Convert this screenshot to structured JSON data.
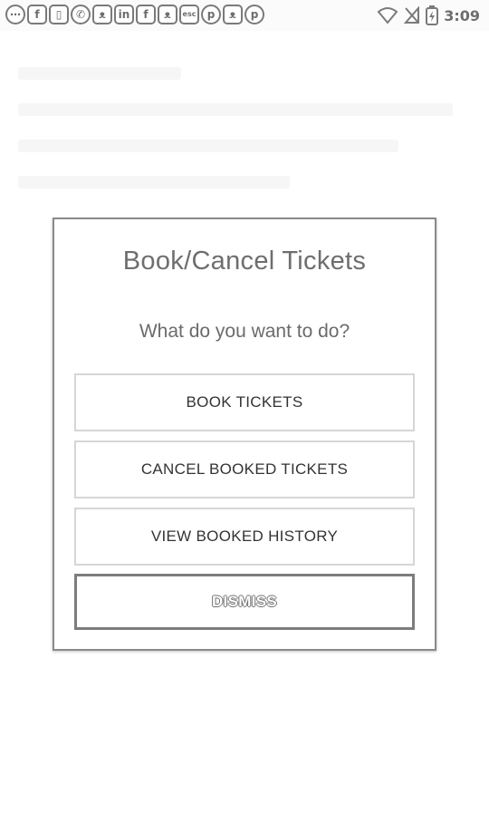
{
  "status_bar": {
    "notification_icons": [
      {
        "name": "more-icon",
        "glyph": "⋯",
        "shape": "round"
      },
      {
        "name": "facebook-icon",
        "glyph": "f",
        "shape": "square"
      },
      {
        "name": "message-icon",
        "glyph": "▯",
        "shape": "square"
      },
      {
        "name": "whatsapp-icon",
        "glyph": "✆",
        "shape": "round"
      },
      {
        "name": "cat-icon",
        "glyph": "ᴥ",
        "shape": "square"
      },
      {
        "name": "linkedin-icon",
        "glyph": "in",
        "shape": "square"
      },
      {
        "name": "facebook-icon-2",
        "glyph": "f",
        "shape": "square"
      },
      {
        "name": "cat-icon-2",
        "glyph": "ᴥ",
        "shape": "square"
      },
      {
        "name": "esc-icon",
        "glyph": "esc",
        "shape": "square"
      },
      {
        "name": "pinterest-icon",
        "glyph": "p",
        "shape": "round"
      },
      {
        "name": "cat-icon-3",
        "glyph": "ᴥ",
        "shape": "square"
      },
      {
        "name": "pinterest-icon-2",
        "glyph": "p",
        "shape": "round"
      }
    ],
    "time": "3:09"
  },
  "dialog": {
    "title": "Book/Cancel Tickets",
    "message": "What do you want to do?",
    "options": {
      "book": "BOOK TICKETS",
      "cancel": "CANCEL BOOKED TICKETS",
      "history": "VIEW BOOKED HISTORY"
    },
    "dismiss_label": "DISMISS"
  }
}
